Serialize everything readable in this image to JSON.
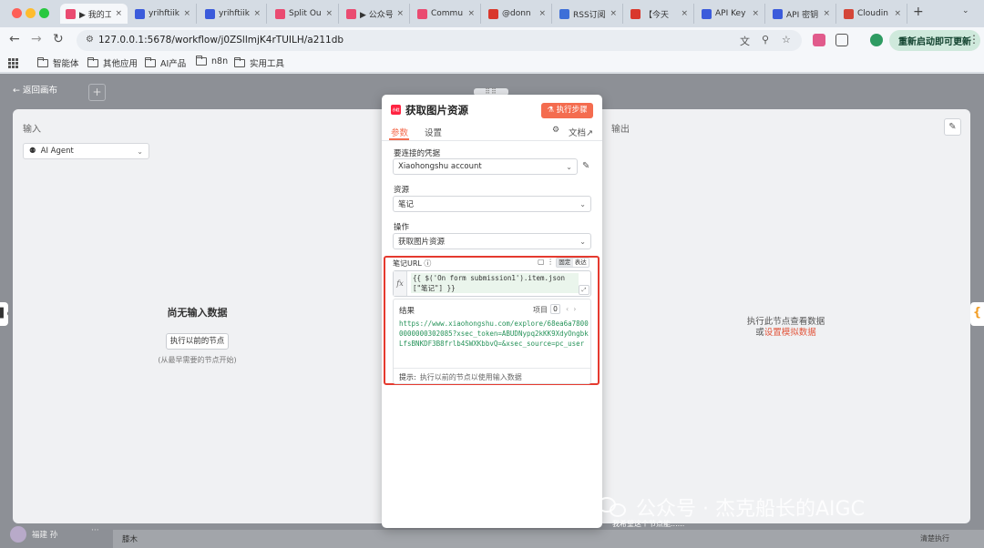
{
  "browser": {
    "tabs": [
      {
        "label": "▶ 我的工",
        "color": "#ea4b71",
        "active": true
      },
      {
        "label": "yrihftiik",
        "color": "#3b5bdb"
      },
      {
        "label": "yrihftiik",
        "color": "#3b5bdb"
      },
      {
        "label": "Split Ou",
        "color": "#ea4b71"
      },
      {
        "label": "▶ 公众号",
        "color": "#ea4b71"
      },
      {
        "label": "Commu",
        "color": "#ea4b71"
      },
      {
        "label": "@donn",
        "color": "#d9382c"
      },
      {
        "label": "RSS订阅",
        "color": "#3d6fd8"
      },
      {
        "label": "【今天",
        "color": "#d9382c"
      },
      {
        "label": "API Key",
        "color": "#3b5bdb"
      },
      {
        "label": "API 密钥",
        "color": "#3b5bdb"
      },
      {
        "label": "Cloudin",
        "color": "#d44638"
      }
    ],
    "tab_close": "×",
    "new_tab": "+",
    "url": "127.0.0.1:5678/workflow/j0ZSllmjK4rTUILH/a211db",
    "relaunch_label": "重新启动即可更新",
    "bookmarks": [
      "智能体",
      "其他应用",
      "AI产品",
      "n8n",
      "实用工具"
    ]
  },
  "canvas": {
    "back_label": "← 返回画布",
    "plus": "+",
    "input": {
      "title": "输入",
      "agent_select": "AI Agent",
      "empty_title": "尚无输入数据",
      "prev_button": "执行以前的节点",
      "prev_hint": "(从最早需要的节点开始)"
    },
    "output": {
      "title": "输出",
      "hint_line1": "执行此节点查看数据",
      "hint_or": "或",
      "hint_link": "设置模拟数据"
    },
    "side_right_glyph": "{",
    "bottom": {
      "user": "福建 孙",
      "log_label": "膝木",
      "ask": "我希望这个节点能......",
      "right_label": "清楚执行"
    }
  },
  "node": {
    "logo_text": "小红书",
    "title": "获取图片资源",
    "execute_label": "执行步骤",
    "tabs": {
      "params": "参数",
      "settings": "设置",
      "docs": "文档"
    },
    "credential": {
      "label": "要连接的凭据",
      "value": "Xiaohongshu account"
    },
    "resource": {
      "label": "资源",
      "value": "笔记"
    },
    "operation": {
      "label": "操作",
      "value": "获取图片资源"
    },
    "note_url": {
      "label": "笔记URL",
      "toggle_fixed": "固定",
      "toggle_expr": "表达",
      "fx": "fx",
      "expression": "{{ $('On form submission1').item.json[\"笔记\"] }}",
      "result_label": "结果",
      "items_label": "项目",
      "items_count": "0",
      "result_url": "https://www.xiaohongshu.com/explore/68ea6a78000000000302085?xsec_token=ABUDNypq2kKK9XdyOngbkLfsBNKDF3B8frlb4SWXKbbvQ=&xsec_source=pc_user",
      "tip_label": "提示:",
      "tip_text": "执行以前的节点以使用输入数据"
    }
  },
  "watermark": "公众号 · 杰克船长的AIGC",
  "colors": {
    "accent": "#f46c4f",
    "highlight": "#e53a2f",
    "result_green": "#27935a"
  }
}
